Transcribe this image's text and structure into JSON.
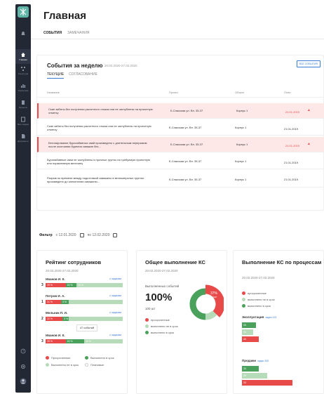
{
  "nav": {
    "items": [
      {
        "label": "Главная"
      },
      {
        "label": "Структура"
      },
      {
        "label": "Аналитика"
      },
      {
        "label": "Проекты"
      },
      {
        "label": "Мои задачи"
      },
      {
        "label": "Документы"
      }
    ]
  },
  "header": {
    "title": "Главная",
    "tabs": [
      "СОБЫТИЯ",
      "ЗАМЕЧАНИЯ"
    ]
  },
  "events": {
    "title": "События за неделю",
    "date_range": "20.02.2020-27.02.2020",
    "all_button": "ВСЕ СОБЫТИЯ",
    "tabs": [
      "ТЕКУЩИЕ",
      "СОГЛАСОВАНИЕ"
    ],
    "columns": [
      "Название",
      "Проект",
      "Объект",
      "План"
    ],
    "rows": [
      {
        "name": "Скан забиты без получения расчетного отказа или не заглублены на проектную отметку",
        "project": "Б.Спасская ул. Вл. 35-37",
        "object": "Корпус 1",
        "plan": "21.01.2019",
        "alert": true
      },
      {
        "name": "Скан забиты без получения расчетного отказа или не заглублены на проектную отметку",
        "project": "Б.Спасская ул. Вл. 35-37",
        "object": "Корпус 1",
        "plan": "21.01.2019",
        "alert": false
      },
      {
        "name": "Бетонирование буронабивных свай произведено с длительным перерывом после окончания бурения скважин без...",
        "project": "Б.Спасская ул. Вл. 35-37",
        "object": "Корпус 1",
        "plan": "21.01.2019",
        "alert": true
      },
      {
        "name": "Буронабивные сваи не заглублены в прочные грунты на требуемую проектную или нормативную величину",
        "project": "Б.Спасская ул. Вл. 35-37",
        "object": "Корпус 1",
        "plan": "21.01.2019",
        "alert": false
      },
      {
        "name": "Разрыв по времени между подготовкой скважины в вечномерзлых грунтах произведено до заполнения скважины...",
        "project": "Б.Спасская ул. Вл. 35-37",
        "object": "Корпус 1",
        "plan": "21.01.2019",
        "alert": false
      }
    ]
  },
  "filter": {
    "label": "Фильтр",
    "from": "с 12.01.2020",
    "to": "по 12.02.2020"
  },
  "rating": {
    "title": "Рейтинг сотрудников",
    "date": "20.02.2020-27.02.2020",
    "link": "к задачам",
    "employees": [
      {
        "rank": "3",
        "name": "Иванов И. К.",
        "red": "29 %",
        "green": "15 %",
        "light": "15 %",
        "red_share": 0.26,
        "green_share": 0.14,
        "light_share": 0.6
      },
      {
        "rank": "1",
        "name": "Петров И. А.",
        "red": "21 %",
        "green": "3 %",
        "light": "",
        "red_share": 0.2,
        "green_share": 0.1,
        "light_share": 0.7
      },
      {
        "rank": "2",
        "name": "Мельник П. И.",
        "red": "22 %",
        "green": "3 %",
        "light": "",
        "red_share": 0.22,
        "green_share": 0.08,
        "light_share": 0.7
      },
      {
        "rank": "3",
        "name": "Иванов И. К.",
        "red": "29 %",
        "green": "15 %",
        "light": "15 %",
        "red_share": 0.26,
        "green_share": 0.24,
        "light_share": 0.5
      }
    ],
    "tooltip": "47 событий",
    "legend": [
      "Просроченные",
      "Выполнено в срок",
      "Выполнено не в срок",
      "Плановые"
    ]
  },
  "overall": {
    "title": "Общее выполнение КС",
    "date": "20.02.2020-27.02.2020",
    "subtitle": "Выполненных событий",
    "percent": "100%",
    "count": "100 шт",
    "donut_label": "37%",
    "donut_sub": "10шт",
    "donut": [
      {
        "name": "просроченные",
        "value": 37,
        "color": "#e84a4a"
      },
      {
        "name": "выполнено не в срок",
        "value": 13,
        "color": "#b6dbb8"
      },
      {
        "name": "выполнено в срок",
        "value": 50,
        "color": "#4aa15c"
      }
    ],
    "legend": [
      "просроченные",
      "выполнено не в срок",
      "выполнено в срок"
    ]
  },
  "process": {
    "title": "Выполнение КС по процессам",
    "date": "20.02.2020-27.02.2020",
    "legend": [
      "просроченные",
      "выполнено не в срок",
      "выполнено в срок"
    ],
    "sections": [
      {
        "name": "Эксплуатация",
        "link": "задач 123",
        "bars": [
          {
            "label": "33",
            "color": "#4aa15c",
            "share": 0.25
          },
          {
            "label": "33",
            "color": "#b6dbb8",
            "share": 0.2
          },
          {
            "label": "40",
            "color": "#e84a4a",
            "share": 0.3
          }
        ]
      },
      {
        "name": "Продажи",
        "link": "задач 330",
        "bars": [
          {
            "label": "33",
            "color": "#4aa15c",
            "share": 0.3
          },
          {
            "label": "33",
            "color": "#b6dbb8",
            "share": 0.45
          },
          {
            "label": "33",
            "color": "#e84a4a",
            "share": 0.9
          }
        ]
      }
    ]
  },
  "colors": {
    "accent": "#3a7bd5",
    "red": "#e84a4a",
    "green": "#4aa15c",
    "lightgreen": "#b6dbb8",
    "sidebar": "#222834"
  }
}
